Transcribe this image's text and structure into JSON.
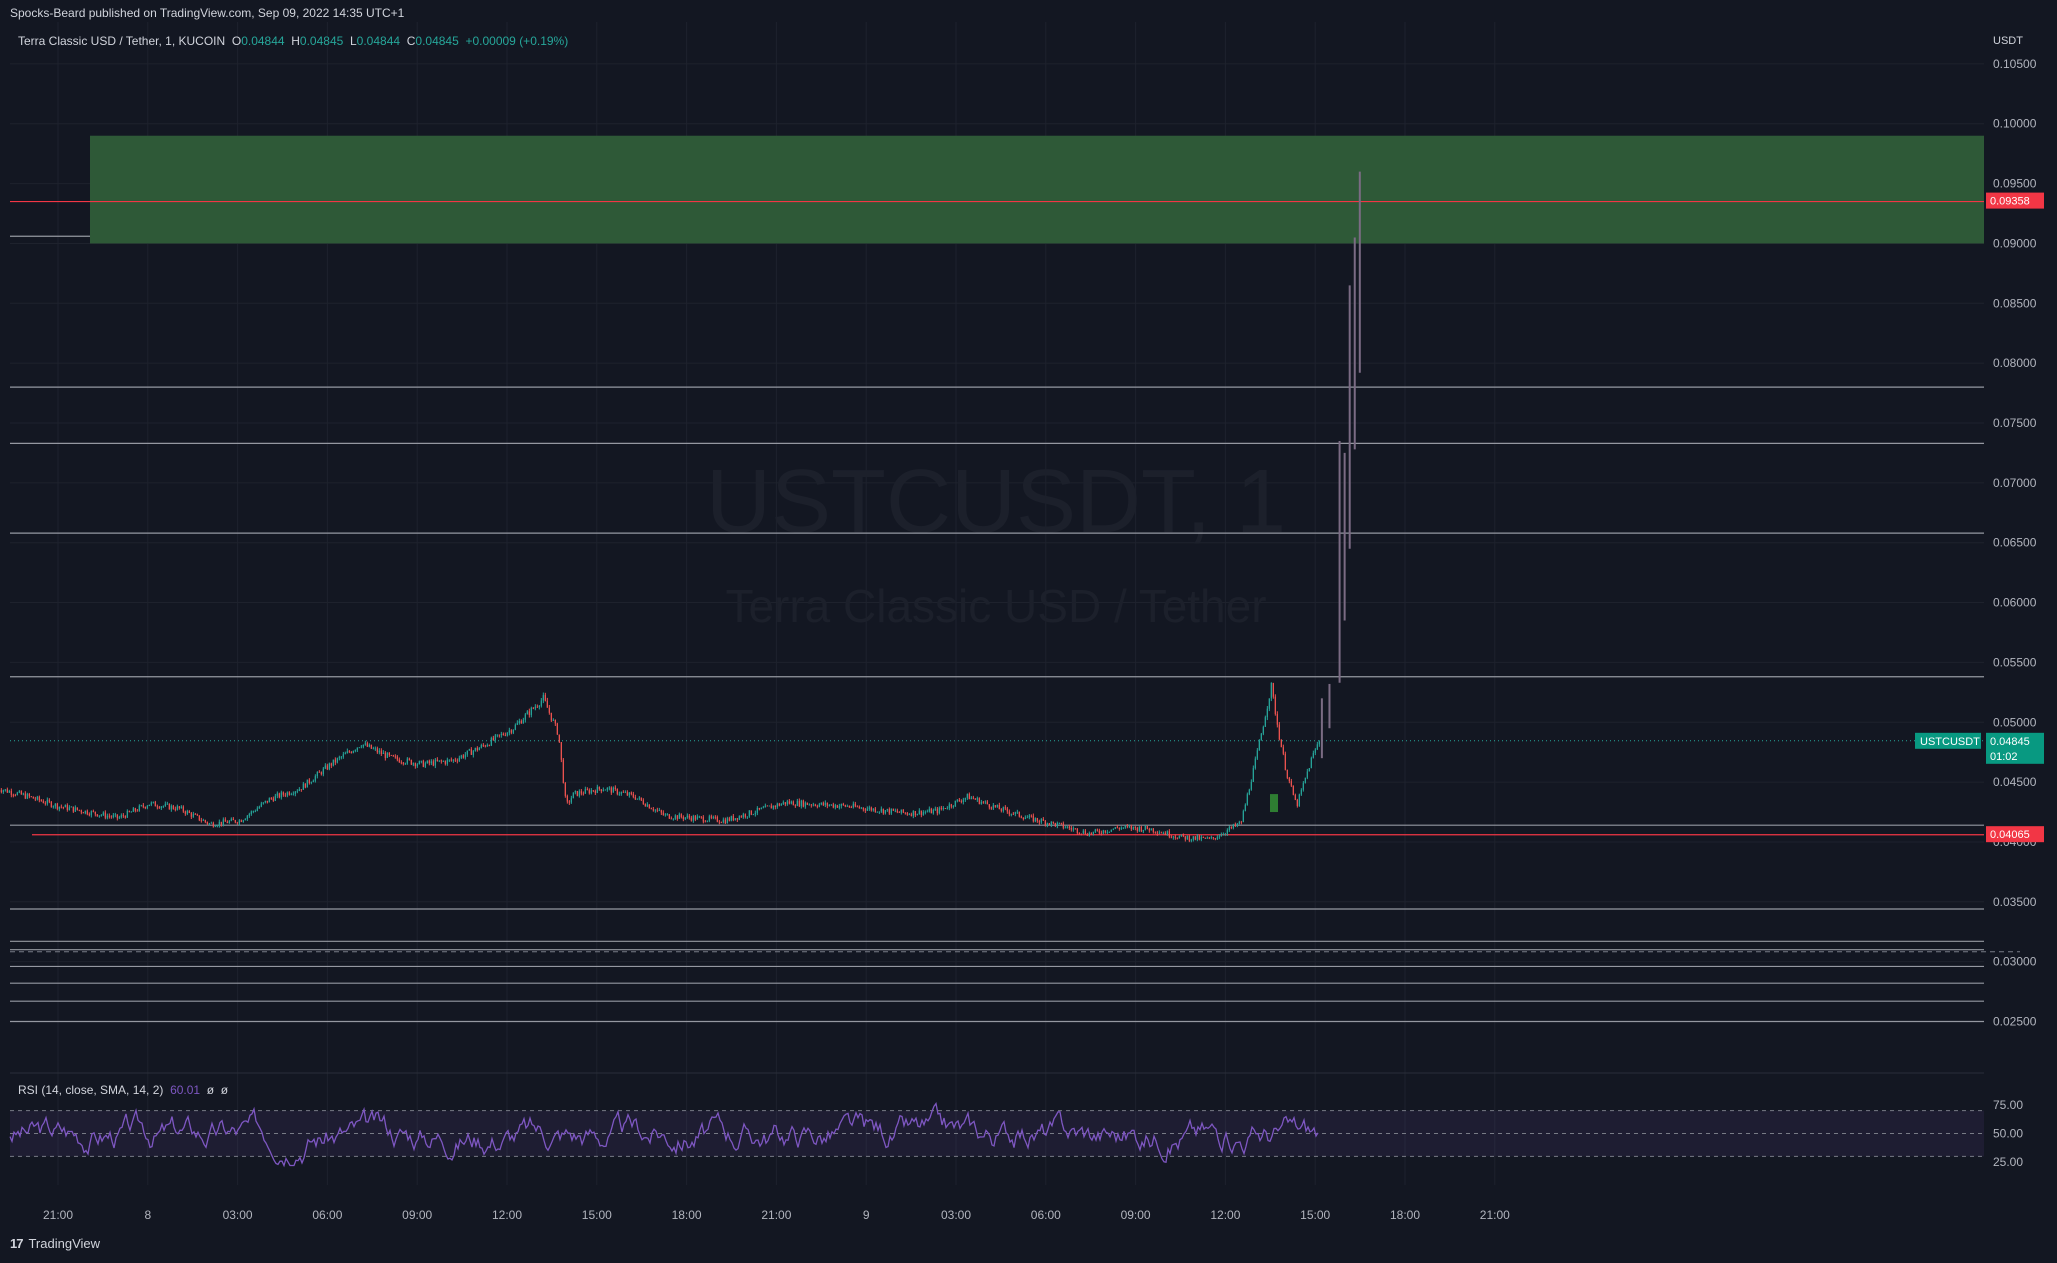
{
  "header": {
    "published": "Spocks-Beard published on TradingView.com, Sep 09, 2022 14:35 UTC+1"
  },
  "legend": {
    "symbol": "Terra Classic USD / Tether, 1, KUCOIN",
    "o_label": "O",
    "o_value": "0.04844",
    "h_label": "H",
    "h_value": "0.04845",
    "l_label": "L",
    "l_value": "0.04844",
    "c_label": "C",
    "c_value": "0.04845",
    "change": "+0.00009 (+0.19%)"
  },
  "watermark": {
    "line1": "USTCUSDT, 1",
    "line2": "Terra Classic USD / Tether"
  },
  "price_axis": {
    "unit": "USDT",
    "ticks": [
      "0.10500",
      "0.10000",
      "0.09500",
      "0.09000",
      "0.08500",
      "0.08000",
      "0.07500",
      "0.07000",
      "0.06500",
      "0.06000",
      "0.05500",
      "0.05000",
      "0.04500",
      "0.04000",
      "0.03500",
      "0.03000",
      "0.02500"
    ]
  },
  "price_labels": {
    "upper_level": "0.09358",
    "current_symbol": "USTCUSDT",
    "current_price": "0.04845",
    "countdown": "01:02",
    "lower_level": "0.04065"
  },
  "time_axis": {
    "ticks": [
      "21:00",
      "8",
      "03:00",
      "06:00",
      "09:00",
      "12:00",
      "15:00",
      "18:00",
      "21:00",
      "9",
      "03:00",
      "06:00",
      "09:00",
      "12:00",
      "15:00",
      "18:00",
      "21:00"
    ]
  },
  "rsi": {
    "label": "RSI (14, close, SMA, 14, 2)",
    "value": "60.01",
    "extra1": "ø",
    "extra2": "ø",
    "ticks": [
      "75.00",
      "50.00",
      "25.00"
    ],
    "band_upper": 70,
    "band_lower": 30,
    "middle": 50
  },
  "footer": {
    "brand": "TradingView",
    "logo_text": "17"
  },
  "colors": {
    "background": "#131722",
    "bull": "#26a69a",
    "bear": "#ef5350",
    "zone": "#2e5937",
    "level_red": "#f23645",
    "rsi_line": "#7e57c2"
  },
  "chart_data": {
    "type": "line",
    "title": "USTCUSDT, 1",
    "subtitle": "Terra Classic USD / Tether",
    "xlabel": "",
    "ylabel": "USDT",
    "ylim": [
      0.0212,
      0.1085
    ],
    "series": [
      {
        "x": [
          "Sep 7 19:00",
          "Sep 7 20:00",
          "Sep 7 21:00",
          "Sep 7 23:00",
          "Sep 8 00:00",
          "Sep 8 01:00",
          "Sep 8 02:00",
          "Sep 8 03:00",
          "Sep 8 04:00",
          "Sep 8 05:00",
          "Sep 8 06:00",
          "Sep 8 07:00",
          "Sep 8 08:00",
          "Sep 8 09:00",
          "Sep 8 10:00",
          "Sep 8 11:00",
          "Sep 8 12:00",
          "Sep 8 13:00",
          "Sep 8 13:30",
          "Sep 8 13:45",
          "Sep 8 14:00",
          "Sep 8 15:00",
          "Sep 8 16:00",
          "Sep 8 17:00",
          "Sep 8 18:00",
          "Sep 8 19:00",
          "Sep 8 21:00",
          "Sep 8 23:00",
          "Sep 9 01:00",
          "Sep 9 02:00",
          "Sep 9 03:00",
          "Sep 9 04:00",
          "Sep 9 05:00",
          "Sep 9 06:00",
          "Sep 9 07:00",
          "Sep 9 08:00",
          "Sep 9 09:00",
          "Sep 9 10:00",
          "Sep 9 11:00",
          "Sep 9 12:00",
          "Sep 9 12:30",
          "Sep 9 13:00",
          "Sep 9 13:15",
          "Sep 9 13:30",
          "Sep 9 13:50",
          "Sep 9 14:20",
          "Sep 9 14:35"
        ],
        "values": [
          0.0445,
          0.0438,
          0.043,
          0.042,
          0.0432,
          0.0428,
          0.0415,
          0.0418,
          0.0436,
          0.0445,
          0.0465,
          0.0482,
          0.047,
          0.0465,
          0.0468,
          0.048,
          0.0495,
          0.052,
          0.049,
          0.043,
          0.044,
          0.0445,
          0.0438,
          0.0422,
          0.042,
          0.0418,
          0.0433,
          0.043,
          0.0424,
          0.0426,
          0.0438,
          0.0428,
          0.042,
          0.0414,
          0.0407,
          0.0412,
          0.0411,
          0.0404,
          0.0402,
          0.0416,
          0.047,
          0.053,
          0.049,
          0.0458,
          0.043,
          0.047,
          0.0485
        ]
      }
    ],
    "rsi_series": {
      "name": "RSI (14, close, SMA, 14, 2)",
      "last": 60.01
    },
    "levels": [
      0.0906,
      0.0935,
      0.078,
      0.0733,
      0.0658,
      0.0538,
      0.0414,
      0.0406,
      0.0344,
      0.0317,
      0.031,
      0.0296,
      0.0282,
      0.0267,
      0.025
    ],
    "zone": {
      "low": 0.09,
      "high": 0.099
    },
    "projection": [
      {
        "x": "Sep 9 14:40",
        "low": 0.047,
        "high": 0.052
      },
      {
        "x": "Sep 9 14:55",
        "low": 0.0495,
        "high": 0.0532
      },
      {
        "x": "Sep 9 15:15",
        "low": 0.0533,
        "high": 0.0735
      },
      {
        "x": "Sep 9 15:25",
        "low": 0.0585,
        "high": 0.0725
      },
      {
        "x": "Sep 9 15:35",
        "low": 0.0645,
        "high": 0.0865
      },
      {
        "x": "Sep 9 15:45",
        "low": 0.0728,
        "high": 0.0905
      },
      {
        "x": "Sep 9 15:55",
        "low": 0.0792,
        "high": 0.096
      }
    ],
    "grid": true,
    "legend": "top-left"
  }
}
